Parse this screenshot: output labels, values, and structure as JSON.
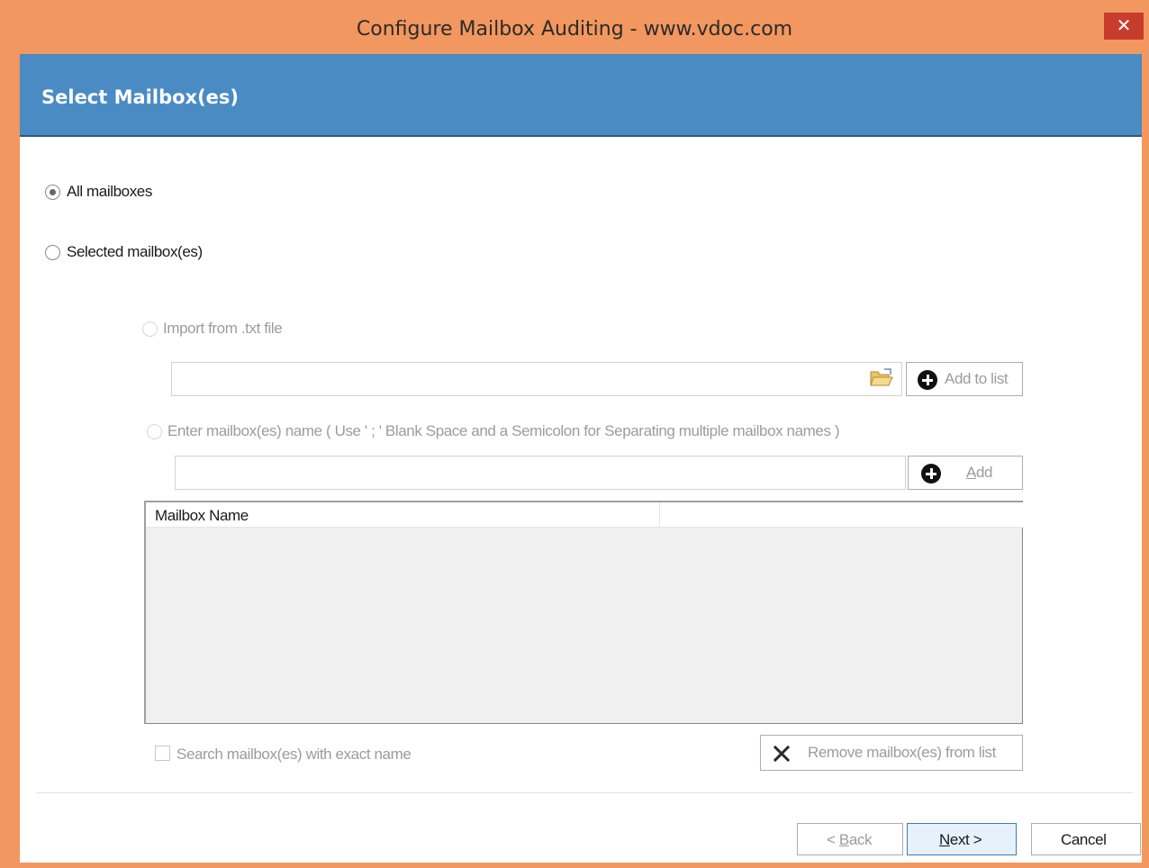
{
  "window": {
    "title": "Configure Mailbox Auditing - www.vdoc.com",
    "close_glyph": "✕"
  },
  "header": {
    "title": "Select Mailbox(es)"
  },
  "options": {
    "all_mailboxes": "All mailboxes",
    "selected_mailboxes": "Selected mailbox(es)",
    "selected_value": "all_mailboxes",
    "import_txt": "Import from .txt file",
    "enter_names": "Enter mailbox(es) name ( Use ' ; ' Blank Space and a Semicolon for Separating multiple mailbox names )"
  },
  "import": {
    "path_value": "",
    "add_to_list_label": "Add to list"
  },
  "enter": {
    "names_value": "",
    "add_label_mnemonic": "A",
    "add_label_rest": "dd"
  },
  "list": {
    "columns": [
      "Mailbox Name",
      ""
    ],
    "rows": []
  },
  "search_exact_label": "Search mailbox(es) with exact name",
  "remove_label": "Remove mailbox(es) from list",
  "footer": {
    "back_prefix": "< ",
    "back_mnemonic": "B",
    "back_rest": "ack",
    "next_mnemonic": "N",
    "next_rest": "ext >",
    "cancel_label": "Cancel"
  },
  "icons": {
    "close": "close-icon",
    "folder": "folder-open-icon",
    "add": "plus-circle-icon",
    "remove": "x-icon"
  }
}
